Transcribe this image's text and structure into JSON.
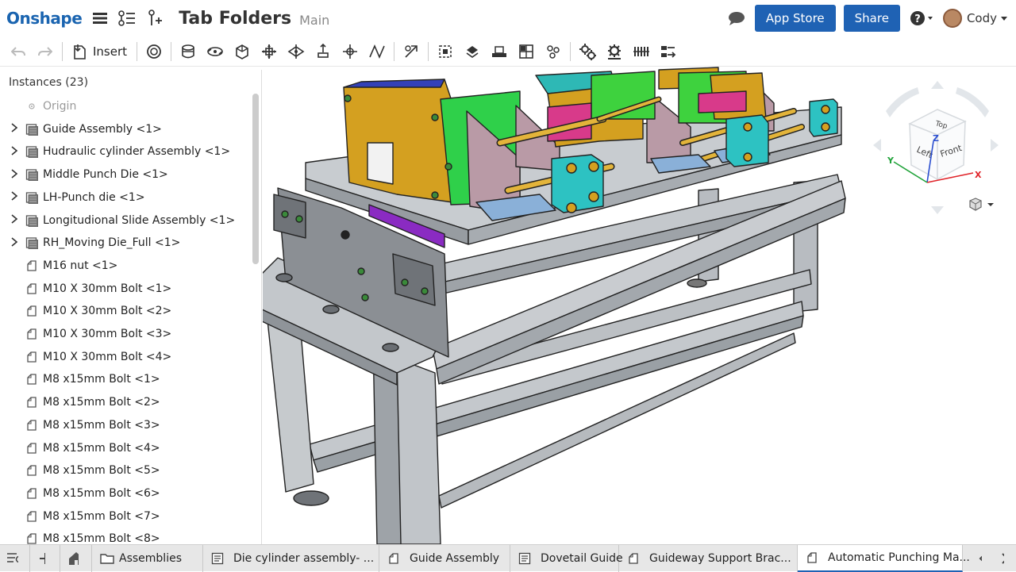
{
  "app": {
    "logo": "Onshape",
    "title": "Tab Folders",
    "branch": "Main"
  },
  "header": {
    "app_store_label": "App Store",
    "share_label": "Share",
    "help_icon": "help-icon",
    "user_name": "Cody"
  },
  "toolbar": {
    "insert_label": "Insert"
  },
  "instances": {
    "header": "Instances (23)",
    "items": [
      {
        "label": "Origin",
        "type": "origin",
        "expandable": false
      },
      {
        "label": "Guide Assembly <1>",
        "type": "assembly",
        "expandable": true
      },
      {
        "label": "Hudraulic cylinder Assembly <1>",
        "type": "assembly",
        "expandable": true
      },
      {
        "label": "Middle Punch Die <1>",
        "type": "assembly",
        "expandable": true
      },
      {
        "label": "LH-Punch die <1>",
        "type": "assembly",
        "expandable": true
      },
      {
        "label": "Longitudional Slide Assembly <1>",
        "type": "assembly",
        "expandable": true
      },
      {
        "label": "RH_Moving Die_Full <1>",
        "type": "assembly",
        "expandable": true
      },
      {
        "label": "M16 nut <1>",
        "type": "part",
        "expandable": false
      },
      {
        "label": "M10 X 30mm Bolt <1>",
        "type": "part",
        "expandable": false
      },
      {
        "label": "M10 X 30mm Bolt <2>",
        "type": "part",
        "expandable": false
      },
      {
        "label": "M10 X 30mm Bolt <3>",
        "type": "part",
        "expandable": false
      },
      {
        "label": "M10 X 30mm Bolt <4>",
        "type": "part",
        "expandable": false
      },
      {
        "label": "M8 x15mm Bolt <1>",
        "type": "part",
        "expandable": false
      },
      {
        "label": "M8 x15mm Bolt <2>",
        "type": "part",
        "expandable": false
      },
      {
        "label": "M8 x15mm Bolt <3>",
        "type": "part",
        "expandable": false
      },
      {
        "label": "M8 x15mm Bolt <4>",
        "type": "part",
        "expandable": false
      },
      {
        "label": "M8 x15mm Bolt <5>",
        "type": "part",
        "expandable": false
      },
      {
        "label": "M8 x15mm Bolt <6>",
        "type": "part",
        "expandable": false
      },
      {
        "label": "M8 x15mm Bolt <7>",
        "type": "part",
        "expandable": false
      },
      {
        "label": "M8 x15mm Bolt <8>",
        "type": "part",
        "expandable": false
      }
    ]
  },
  "view_cube": {
    "top": "Top",
    "left": "Left",
    "front": "Front",
    "axis_x": "X",
    "axis_y": "Y",
    "axis_z": "Z"
  },
  "tabs": [
    {
      "label": "Assemblies",
      "icon": "folder-icon"
    },
    {
      "label": "Die cylinder assembly- ...",
      "icon": "part-studio-icon"
    },
    {
      "label": "Guide Assembly",
      "icon": "assembly-icon"
    },
    {
      "label": "Dovetail Guide",
      "icon": "part-studio-icon"
    },
    {
      "label": "Guideway Support Brac...",
      "icon": "assembly-icon"
    },
    {
      "label": "Automatic Punching Ma...",
      "icon": "assembly-icon",
      "active": true
    }
  ],
  "colors": {
    "brand": "#1a64b0",
    "button": "#1f62b4",
    "frame_gray": "#b4b8bd",
    "yellow_plate": "#d29a1e",
    "green_plate": "#3ec83e",
    "cyan_block": "#2fc0c0",
    "pink_plate": "#b89aa8"
  }
}
